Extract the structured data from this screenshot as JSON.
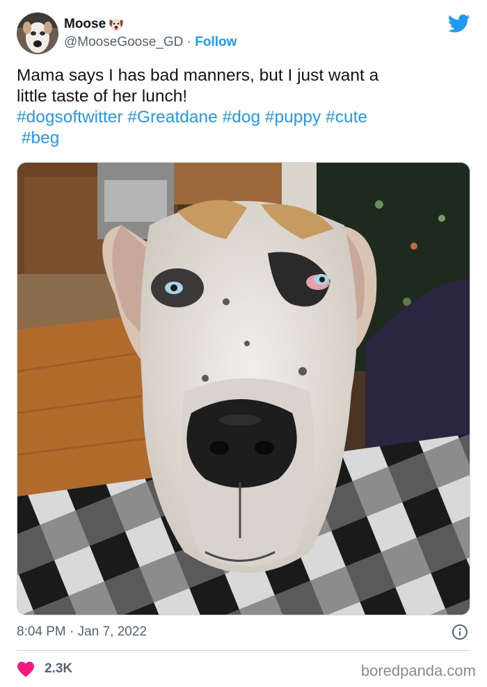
{
  "author": {
    "display_name": "Moose",
    "display_name_emoji": "dog-face-icon",
    "handle": "@MooseGoose_GD",
    "separator": " · ",
    "follow_label": "Follow"
  },
  "tweet": {
    "text_line_1": "Mama says I has bad manners, but I just want a",
    "text_line_2": "little taste of her lunch!",
    "hashtags": [
      "#dogsoftwitter",
      "#Greatdane",
      "#dog",
      "#puppy",
      "#cute",
      "#beg"
    ]
  },
  "media": {
    "icon": "great-dane-photo"
  },
  "meta": {
    "time": "8:04 PM",
    "separator": " · ",
    "date": "Jan 7, 2022",
    "info_icon": "info-icon"
  },
  "engagement": {
    "like_icon": "heart-icon",
    "like_count": "2.3K"
  },
  "watermark": "boredpanda.com",
  "colors": {
    "accent": "#1d9bf0",
    "like": "#f91880",
    "text": "#0f1419",
    "secondary": "#536471"
  }
}
